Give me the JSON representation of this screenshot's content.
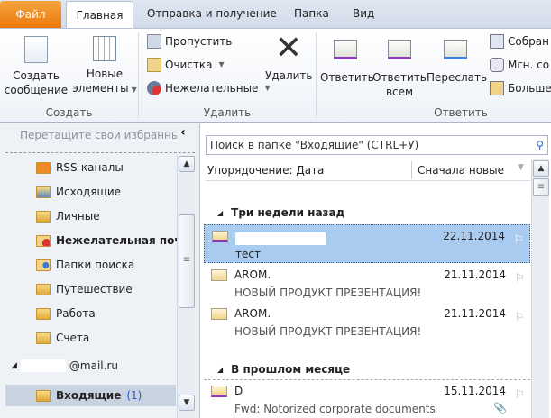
{
  "tabs": {
    "file": "Файл",
    "home": "Главная",
    "send_receive": "Отправка и получение",
    "folder": "Папка",
    "view": "Вид"
  },
  "ribbon": {
    "create_group": {
      "label": "Создать",
      "new_message": [
        "Создать",
        "сообщение"
      ],
      "new_items": [
        "Новые",
        "элементы"
      ]
    },
    "delete_group": {
      "label": "Удалить",
      "ignore": "Пропустить",
      "cleanup": "Очистка",
      "junk": "Нежелательные",
      "delete": "Удалить"
    },
    "reply_group": {
      "label": "Ответить",
      "reply": "Ответить",
      "reply_all": [
        "Ответить",
        "всем"
      ],
      "forward": "Переслать",
      "meeting": "Собран",
      "im": "Мгн. со",
      "more": "Больше"
    }
  },
  "nav": {
    "favorites_hint": "Перетащите свои избранные",
    "folders": [
      {
        "label": "RSS-каналы",
        "bold": false
      },
      {
        "label": "Исходящие",
        "bold": false
      },
      {
        "label": "Личные",
        "bold": false
      },
      {
        "label": "Нежелательная почта",
        "bold": true
      },
      {
        "label": "Папки поиска",
        "bold": false
      },
      {
        "label": "Путешествие",
        "bold": false
      },
      {
        "label": "Работа",
        "bold": false
      },
      {
        "label": "Счета",
        "bold": false
      }
    ],
    "account": "@mail.ru",
    "inbox": {
      "label": "Входящие",
      "count": "(1)"
    }
  },
  "list": {
    "search_placeholder": "Поиск в папке \"Входящие\" (CTRL+У)",
    "arrange": "Упорядочение: Дата",
    "order": "Сначала новые",
    "groups": [
      {
        "label": "Три недели назад"
      },
      {
        "label": "В прошлом месяце"
      }
    ],
    "messages": [
      {
        "from": "",
        "date": "22.11.2014",
        "subject": "тест",
        "selected": true
      },
      {
        "from": "AROM.",
        "date": "21.11.2014",
        "subject": "НОВЫЙ ПРОДУКТ ПРЕЗЕНТАЦИЯ!"
      },
      {
        "from": "AROM.",
        "date": "21.11.2014",
        "subject": "НОВЫЙ ПРОДУКТ ПРЕЗЕНТАЦИЯ!"
      },
      {
        "from": "D",
        "date": "15.11.2014",
        "subject": "Fwd: Notorized corporate documents",
        "attachment": true
      }
    ]
  }
}
